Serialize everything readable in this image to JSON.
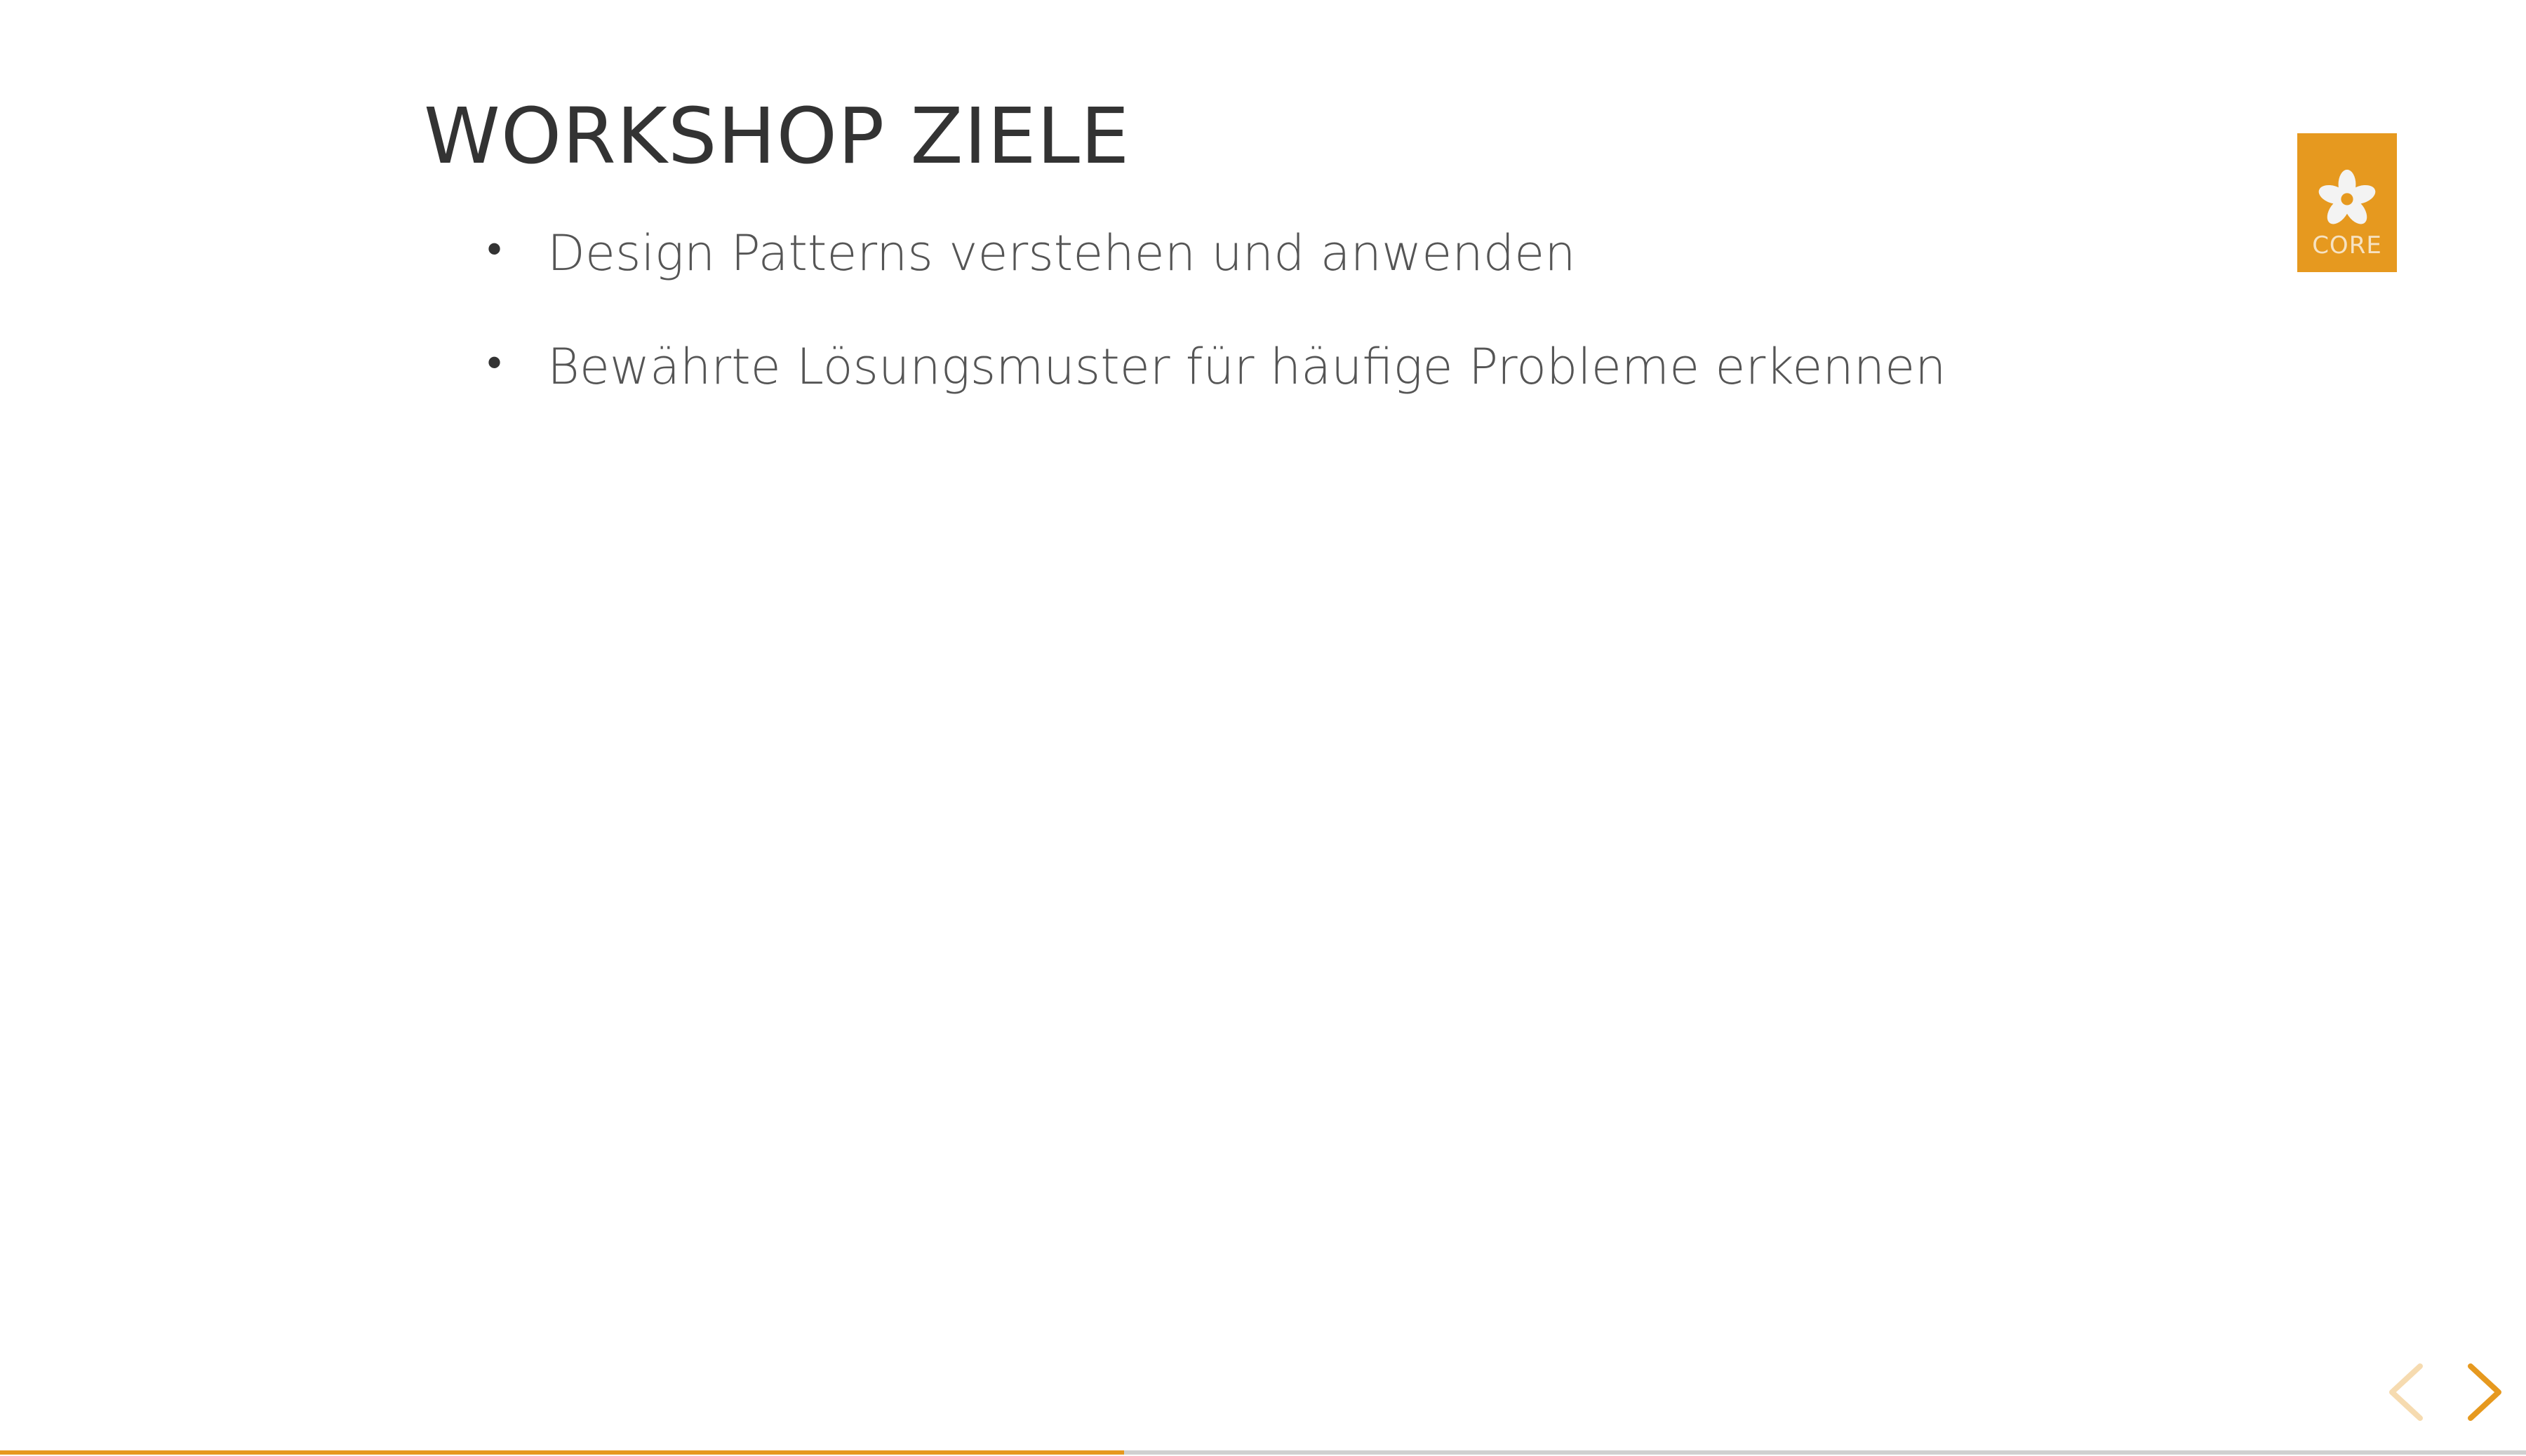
{
  "slide": {
    "title": "WORKSHOP ZIELE",
    "bullets": [
      "Design Patterns verstehen und anwenden",
      "Bewährte Lösungsmuster für häufige Probleme erkennen"
    ],
    "bullet_glyph": "•"
  },
  "logo": {
    "text": "CORE",
    "icon": "flower-icon",
    "color": "#e6991f"
  },
  "navigation": {
    "prev_icon": "chevron-left-icon",
    "next_icon": "chevron-right-icon",
    "color": "#e6991f"
  },
  "progress": {
    "value": 0.445,
    "fill_color": "#e6991f",
    "track_color": "#d0d0d0"
  }
}
